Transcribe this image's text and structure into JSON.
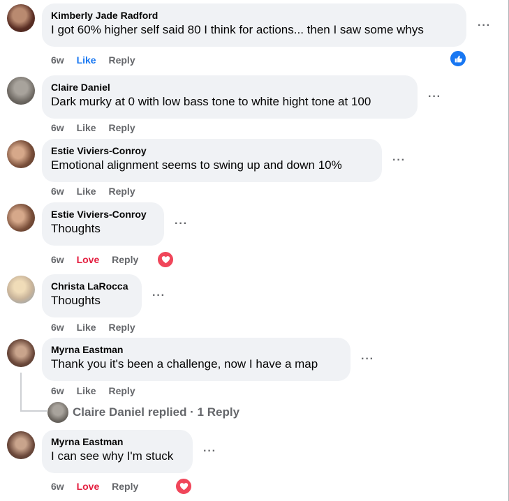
{
  "comments": [
    {
      "author": "Kimberly Jade Radford",
      "text": "I got 60% higher self said 80 I think for actions... then I saw some whys",
      "time": "6w",
      "reaction_label": "Like",
      "reply_label": "Reply",
      "reaction": "like",
      "avatar_color": "#5a2e24"
    },
    {
      "author": "Claire Daniel",
      "text": "Dark murky at 0 with low bass tone to white hight tone at 100",
      "time": "6w",
      "reaction_label": "Like",
      "reply_label": "Reply",
      "avatar_color": "#6b6660"
    },
    {
      "author": "Estie Viviers-Conroy",
      "text": "Emotional alignment seems to swing up and down 10%",
      "time": "6w",
      "reaction_label": "Like",
      "reply_label": "Reply",
      "avatar_color": "#7a4f3a"
    },
    {
      "author": "Estie Viviers-Conroy",
      "text": "Thoughts",
      "time": "6w",
      "reaction_label": "Love",
      "reply_label": "Reply",
      "reaction": "love",
      "avatar_color": "#7a4f3a"
    },
    {
      "author": "Christa LaRocca",
      "text": "Thoughts",
      "time": "6w",
      "reaction_label": "Like",
      "reply_label": "Reply",
      "avatar_color": "#c9b49a"
    },
    {
      "author": "Myrna Eastman",
      "text": "Thank you it's been a challenge, now I have a map",
      "time": "6w",
      "reaction_label": "Like",
      "reply_label": "Reply",
      "avatar_color": "#6d4a3c"
    },
    {
      "author": "Myrna Eastman",
      "text": "I can see why I'm stuck",
      "time": "6w",
      "reaction_label": "Love",
      "reply_label": "Reply",
      "reaction": "love",
      "avatar_color": "#6d4a3c"
    }
  ],
  "replies_summary": {
    "text": "Claire Daniel replied · 1 Reply"
  },
  "more_label": "···",
  "colors": {
    "bubble": "#f0f2f5",
    "secondary_text": "#65676b",
    "like_blue": "#1877f2",
    "love_red": "#e41e3f"
  }
}
